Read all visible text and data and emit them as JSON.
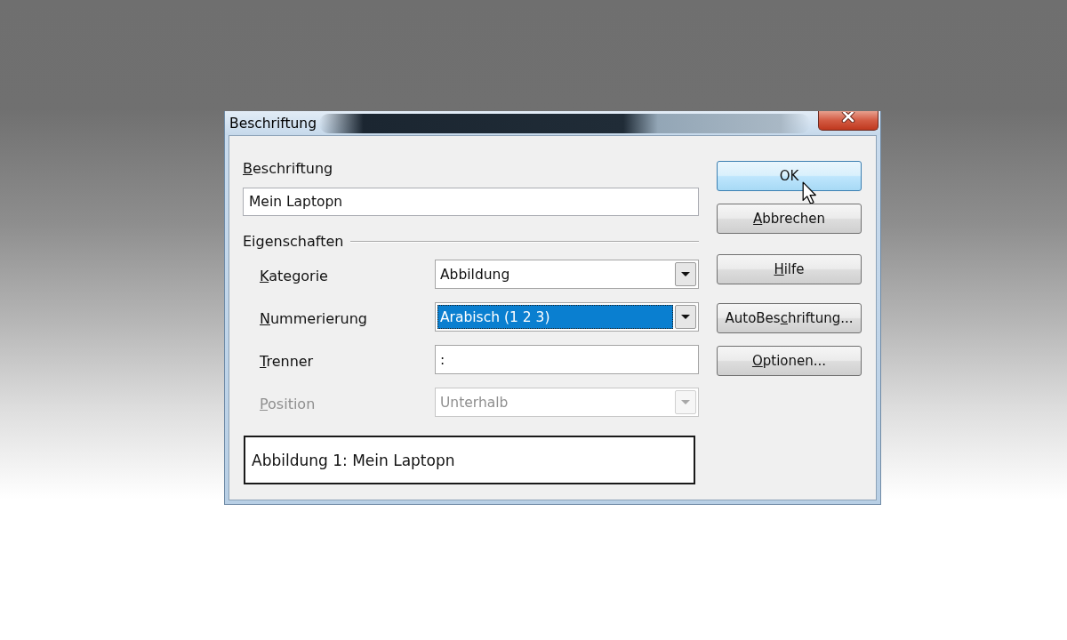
{
  "window": {
    "title": "Beschriftung"
  },
  "caption": {
    "label": {
      "access_key": "B",
      "rest": "eschriftung"
    },
    "value": "Mein Laptopn"
  },
  "properties": {
    "heading": "Eigenschaften",
    "rows": [
      {
        "kind": "dropdown",
        "label": {
          "access_key": "K",
          "rest": "ategorie"
        },
        "value": "Abbildung",
        "focused": false,
        "disabled": false
      },
      {
        "kind": "dropdown",
        "label": {
          "access_key": "N",
          "rest": "ummerierung"
        },
        "value": "Arabisch (1 2 3)",
        "focused": true,
        "disabled": false
      },
      {
        "kind": "text",
        "label": {
          "access_key": "T",
          "rest": "renner"
        },
        "value": ":",
        "focused": false,
        "disabled": false
      },
      {
        "kind": "dropdown",
        "label": {
          "access_key": "P",
          "rest": "osition"
        },
        "value": "Unterhalb",
        "focused": false,
        "disabled": true
      }
    ]
  },
  "preview": "Abbildung 1: Mein Laptopn",
  "buttons": [
    {
      "label": {
        "lead": "OK"
      },
      "hovered": true
    },
    {
      "label": {
        "access_key": "A",
        "rest": "bbrechen"
      },
      "hovered": false
    },
    {
      "label": {
        "access_key": "H",
        "rest": "ilfe"
      },
      "hovered": false
    },
    {
      "label": {
        "lead": "AutoBes",
        "access_key": "c",
        "rest": "hriftung..."
      },
      "hovered": false
    },
    {
      "label": {
        "access_key": "O",
        "rest": "ptionen..."
      },
      "hovered": false
    }
  ]
}
